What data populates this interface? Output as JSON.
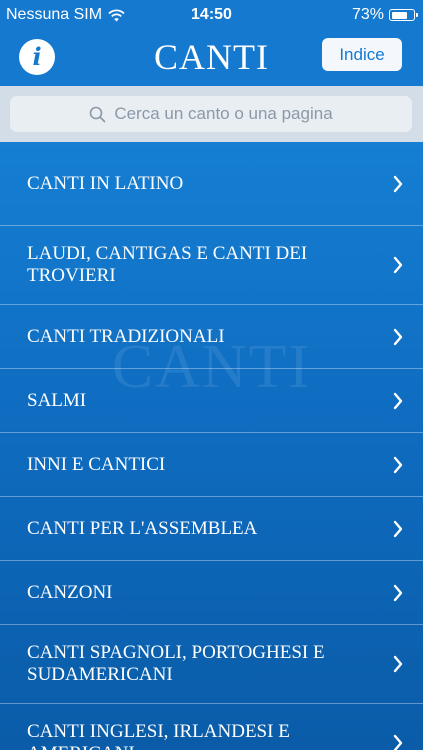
{
  "status_bar": {
    "carrier": "Nessuna SIM",
    "time": "14:50",
    "battery_percent": "73%",
    "battery_level": 0.73,
    "wifi_icon": "wifi-icon",
    "battery_icon": "battery-icon"
  },
  "nav": {
    "info_icon": "info-icon",
    "info_glyph": "i",
    "title": "CANTI",
    "index_label": "Indice"
  },
  "search": {
    "icon": "search-icon",
    "placeholder": "Cerca un canto o una pagina"
  },
  "watermark": "CANTI",
  "list": {
    "chevron_icon": "chevron-right-icon",
    "items": [
      {
        "label": "CANTI IN LATINO"
      },
      {
        "label": "LAUDI, CANTIGAS E CANTI DEI TROVIERI"
      },
      {
        "label": "CANTI TRADIZIONALI"
      },
      {
        "label": "SALMI"
      },
      {
        "label": "INNI E CANTICI"
      },
      {
        "label": "CANTI PER L'ASSEMBLEA"
      },
      {
        "label": "CANZONI"
      },
      {
        "label": "CANTI SPAGNOLI, PORTOGHESI E SUDAMERICANI"
      },
      {
        "label": "CANTI INGLESI, IRLANDESI E AMERICANI"
      }
    ]
  },
  "colors": {
    "nav_bar": "#1479cf",
    "list_background": "#0f6cc0",
    "search_area": "#d3dde7",
    "text_light": "#ffffff"
  }
}
